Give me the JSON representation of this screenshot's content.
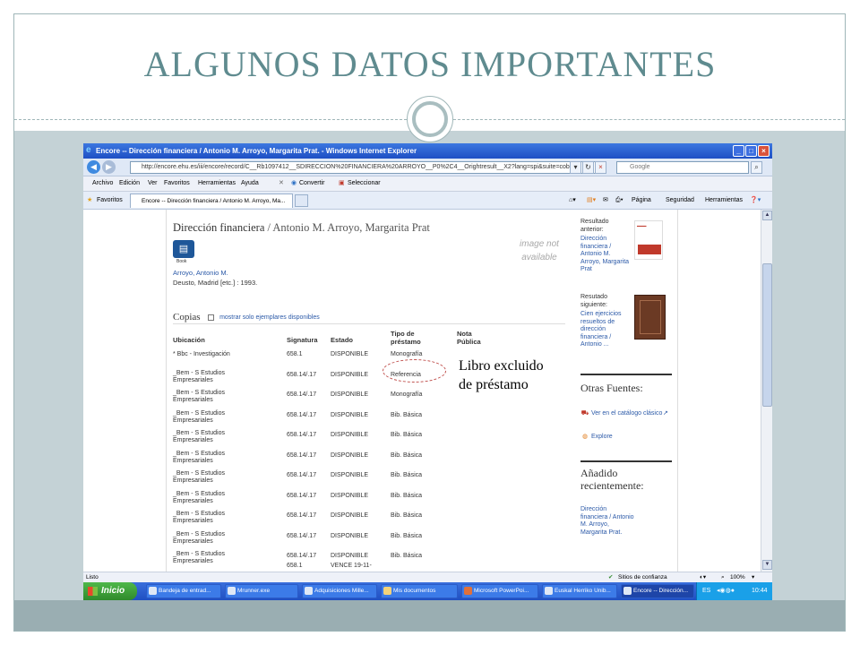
{
  "slide": {
    "title": "ALGUNOS DATOS IMPORTANTES",
    "annotation": "Libro excluido de préstamo"
  },
  "browser": {
    "window_title": "Encore -- Dirección financiera / Antonio M. Arroyo, Margarita Prat. - Windows Internet Explorer",
    "address": "http://encore.ehu.es/iii/encore/record/C__Rb1097412__SDIRECCION%20FINANCIERA%20ARROYO__P0%2C4__Orightresult__X2?lang=spi&suite=cobalt",
    "search_placeholder": "Google",
    "menu": [
      "Archivo",
      "Edición",
      "Ver",
      "Favoritos",
      "Herramientas",
      "Ayuda"
    ],
    "toolbar": {
      "convert": "Convertir",
      "select": "Seleccionar"
    },
    "favorites_label": "Favoritos",
    "tab_label": "Encore -- Dirección financiera / Antonio M. Arroyo, Ma...",
    "command_bar": {
      "page": "Página",
      "security": "Seguridad",
      "tools": "Herramientas"
    },
    "status": {
      "left": "Listo",
      "zone": "Sitios de confianza",
      "zoom": "100%"
    }
  },
  "record": {
    "title": "Dirección financiera",
    "author_sep": " / Antonio M. Arroyo, Margarita Prat",
    "format": "Book",
    "image_na": "image not available",
    "author_link": "Arroyo, Antonio M.",
    "publication": "Deusto, Madrid [etc.] : 1993."
  },
  "copies": {
    "heading": "Copias",
    "available_only": "mostrar solo ejemplares disponibles",
    "headers": {
      "location": "Ubicación",
      "callno": "Signatura",
      "status": "Estado",
      "loan_type": "Tipo de préstamo",
      "public_note": "Nota Pública"
    },
    "rows": [
      {
        "location": "* Bbc - Investigación",
        "callno": "658.1",
        "status": "DISPONIBLE",
        "type": "Monografía"
      },
      {
        "location": "_Bem - S Estudios Empresariales",
        "callno": "658.14/.17",
        "status": "DISPONIBLE",
        "type": "Referencia"
      },
      {
        "location": "_Bem - S Estudios Empresariales",
        "callno": "658.14/.17",
        "status": "DISPONIBLE",
        "type": "Monografía"
      },
      {
        "location": "_Bem - S Estudios Empresariales",
        "callno": "658.14/.17",
        "status": "DISPONIBLE",
        "type": "Bib. Básica"
      },
      {
        "location": "_Bem - S Estudios Empresariales",
        "callno": "658.14/.17",
        "status": "DISPONIBLE",
        "type": "Bib. Básica"
      },
      {
        "location": "_Bem - S Estudios Empresariales",
        "callno": "658.14/.17",
        "status": "DISPONIBLE",
        "type": "Bib. Básica"
      },
      {
        "location": "_Bem - S Estudios Empresariales",
        "callno": "658.14/.17",
        "status": "DISPONIBLE",
        "type": "Bib. Básica"
      },
      {
        "location": "_Bem - S Estudios Empresariales",
        "callno": "658.14/.17",
        "status": "DISPONIBLE",
        "type": "Bib. Básica"
      },
      {
        "location": "_Bem - S Estudios Empresariales",
        "callno": "658.14/.17",
        "status": "DISPONIBLE",
        "type": "Bib. Básica"
      },
      {
        "location": "_Bem - S Estudios Empresariales",
        "callno": "658.14/.17",
        "status": "DISPONIBLE",
        "type": "Bib. Básica"
      },
      {
        "location": "_Bem - S Estudios Empresariales",
        "callno": "658.14/.17",
        "status": "DISPONIBLE",
        "type": "Bib. Básica"
      }
    ],
    "partial_row": {
      "callno": "658.1",
      "status": "VENCE 19-11-"
    }
  },
  "sidebar": {
    "prev_label": "Resultado anterior:",
    "prev_title": "Dirección financiera / Antonio M. Arroyo, Margarita Prat",
    "next_label": "Resutado siguiente:",
    "next_title": "Cien ejercicios resueltos de dirección financiera / Antonio ...",
    "other_sources": "Otras Fuentes:",
    "catalog_link": "Ver en el catálogo clásico",
    "explore": "Explore",
    "recent_heading": "Añadido recientemente:",
    "recent_title": "Dirección financiera / Antonio M. Arroyo, Margarita Prat."
  },
  "taskbar": {
    "start": "Inicio",
    "items": [
      "Bandeja de entrad...",
      "Mrunner.exe",
      "Adquisiciones Mille...",
      "Mis documentos",
      "Microsoft PowerPoi...",
      "Euskal Herriko Unib...",
      "Encore -- Dirección..."
    ],
    "lang": "ES",
    "time": "10:44"
  },
  "colors": {
    "title": "#5f8b8f",
    "band": "#c4d2d6",
    "link": "#2c5aa8",
    "oval": "#c0504d"
  }
}
